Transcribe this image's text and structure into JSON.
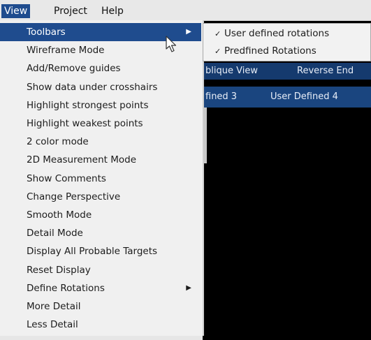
{
  "menubar": {
    "items": [
      {
        "label": "View",
        "underline": "V",
        "active": true
      },
      {
        "label": "Project",
        "underline": "P",
        "active": false
      },
      {
        "label": "Help",
        "underline": "H",
        "active": false
      }
    ]
  },
  "view_menu": {
    "items": [
      {
        "label": "Toolbars",
        "has_submenu": true,
        "highlighted": true
      },
      {
        "label": "Wireframe Mode"
      },
      {
        "label": "Add/Remove guides"
      },
      {
        "label": "Show data under crosshairs"
      },
      {
        "label": "Highlight strongest points"
      },
      {
        "label": "Highlight weakest points"
      },
      {
        "label": "2 color mode"
      },
      {
        "label": "2D Measurement Mode"
      },
      {
        "label": "Show Comments"
      },
      {
        "label": "Change Perspective"
      },
      {
        "label": "Smooth Mode"
      },
      {
        "label": "Detail Mode"
      },
      {
        "label": "Display All Probable Targets"
      },
      {
        "label": "Reset Display"
      },
      {
        "label": "Define Rotations",
        "has_submenu": true
      },
      {
        "label": "More Detail"
      },
      {
        "label": "Less Detail"
      }
    ]
  },
  "toolbars_submenu": {
    "items": [
      {
        "label": "User defined rotations",
        "checked": true
      },
      {
        "label": "Predfined Rotations",
        "checked": true
      }
    ]
  },
  "toolbar_rows": {
    "row1": [
      "blique View",
      "Reverse End"
    ],
    "row2": [
      "fined 3",
      "User Defined 4"
    ]
  },
  "colors": {
    "highlight": "#1f4c8e",
    "menu_bg": "#f0f0f0",
    "toolbar_bg": "#153a6e",
    "app_bg": "#000000"
  }
}
